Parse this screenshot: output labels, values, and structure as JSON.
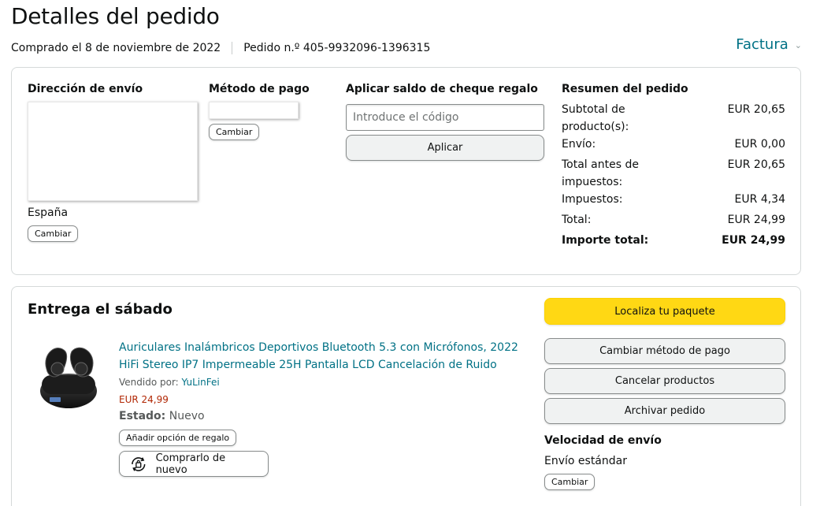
{
  "page": {
    "title": "Detalles del pedido",
    "purchased": "Comprado el 8 de noviembre de 2022",
    "order_number": "Pedido n.º 405-9932096-1396315",
    "invoice_label": "Factura"
  },
  "shipping": {
    "title": "Dirección de envío",
    "country": "España",
    "change_label": "Cambiar"
  },
  "payment": {
    "title": "Método de pago",
    "change_label": "Cambiar"
  },
  "gift": {
    "title": "Aplicar saldo de cheque regalo",
    "placeholder": "Introduce el código",
    "apply_label": "Aplicar"
  },
  "summary": {
    "title": "Resumen del pedido",
    "rows": [
      {
        "label": "Subtotal de producto(s):",
        "value": "EUR 20,65"
      },
      {
        "label": "Envío:",
        "value": "EUR 0,00"
      },
      {
        "label": "Total antes de impuestos:",
        "value": "EUR 20,65"
      },
      {
        "label": "Impuestos:",
        "value": "EUR 4,34"
      },
      {
        "label": "Total:",
        "value": "EUR 24,99"
      },
      {
        "label": "Importe total:",
        "value": "EUR 24,99"
      }
    ]
  },
  "delivery": {
    "title": "Entrega el sábado",
    "product_title": "Auriculares Inalámbricos Deportivos Bluetooth 5.3 con Micrófonos, 2022 HiFi Stereo IP7 Impermeable 25H Pantalla LCD Cancelación de Ruido",
    "sold_by_label": "Vendido por:",
    "seller": "YuLinFei",
    "price": "EUR 24,99",
    "status_label": "Estado:",
    "status_value": "Nuevo",
    "gift_option_label": "Añadir opción de regalo",
    "buy_again_label": "Comprarlo de nuevo"
  },
  "actions": {
    "track": "Localiza tu paquete",
    "change_payment": "Cambiar método de pago",
    "cancel": "Cancelar productos",
    "archive": "Archivar pedido"
  },
  "shipping_speed": {
    "title": "Velocidad de envío",
    "value": "Envío estándar",
    "change_label": "Cambiar"
  },
  "colors": {
    "link": "#007185",
    "price": "#b12704",
    "primary_button": "#ffd814",
    "secondary_button": "#f0f2f2"
  }
}
